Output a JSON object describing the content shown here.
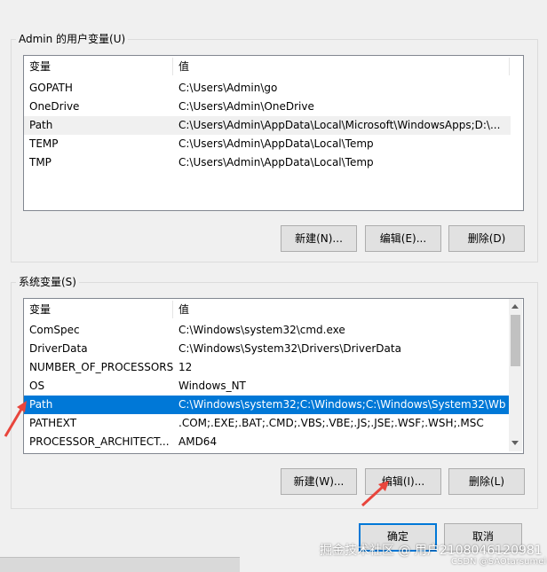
{
  "user_group": {
    "title": "Admin 的用户变量(U)",
    "columns": [
      "变量",
      "值"
    ],
    "rows": [
      {
        "name": "GOPATH",
        "value": "C:\\Users\\Admin\\go"
      },
      {
        "name": "OneDrive",
        "value": "C:\\Users\\Admin\\OneDrive"
      },
      {
        "name": "Path",
        "value": "C:\\Users\\Admin\\AppData\\Local\\Microsoft\\WindowsApps;D:\\..."
      },
      {
        "name": "TEMP",
        "value": "C:\\Users\\Admin\\AppData\\Local\\Temp"
      },
      {
        "name": "TMP",
        "value": "C:\\Users\\Admin\\AppData\\Local\\Temp"
      }
    ],
    "buttons": {
      "new": "新建(N)...",
      "edit": "编辑(E)...",
      "delete": "删除(D)"
    }
  },
  "system_group": {
    "title": "系统变量(S)",
    "columns": [
      "变量",
      "值"
    ],
    "rows": [
      {
        "name": "ComSpec",
        "value": "C:\\Windows\\system32\\cmd.exe"
      },
      {
        "name": "DriverData",
        "value": "C:\\Windows\\System32\\Drivers\\DriverData"
      },
      {
        "name": "NUMBER_OF_PROCESSORS",
        "value": "12"
      },
      {
        "name": "OS",
        "value": "Windows_NT"
      },
      {
        "name": "Path",
        "value": "C:\\Windows\\system32;C:\\Windows;C:\\Windows\\System32\\Wb..."
      },
      {
        "name": "PATHEXT",
        "value": ".COM;.EXE;.BAT;.CMD;.VBS;.VBE;.JS;.JSE;.WSF;.WSH;.MSC"
      },
      {
        "name": "PROCESSOR_ARCHITECT...",
        "value": "AMD64"
      }
    ],
    "buttons": {
      "new": "新建(W)...",
      "edit": "编辑(I)...",
      "delete": "删除(L)"
    }
  },
  "dialog_buttons": {
    "ok": "确定",
    "cancel": "取消"
  },
  "watermark": {
    "text": "掘金技术社区 @ 用户2108046120981",
    "sub": "CSDN @SAOtarsumei"
  },
  "colors": {
    "selection": "#0078d7",
    "arrow": "#e8453c"
  }
}
